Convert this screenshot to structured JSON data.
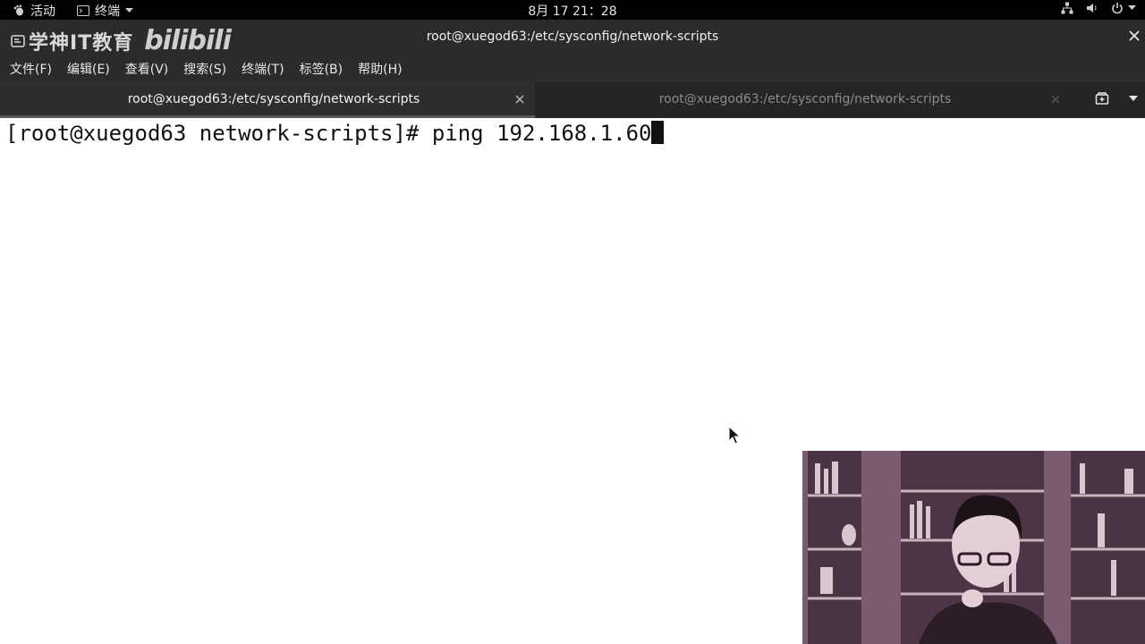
{
  "topbar": {
    "activities": "活动",
    "app_menu": "终端",
    "clock": "8月 17  21：28"
  },
  "window": {
    "title": "root@xuegod63:/etc/sysconfig/network-scripts",
    "logo_text": "学神IT教育",
    "logo_bili": "bilibili"
  },
  "menubar": {
    "items": [
      "文件(F)",
      "编辑(E)",
      "查看(V)",
      "搜索(S)",
      "终端(T)",
      "标签(B)",
      "帮助(H)"
    ]
  },
  "tabs": [
    {
      "label": "root@xuegod63:/etc/sysconfig/network-scripts",
      "active": true
    },
    {
      "label": "root@xuegod63:/etc/sysconfig/network-scripts",
      "active": false
    }
  ],
  "terminal": {
    "prompt": "[root@xuegod63 network-scripts]# ",
    "command": "ping 192.168.1.60"
  },
  "colors": {
    "terminal_bg": "#ffffff",
    "chrome_bg": "#2b2b2b",
    "topbar_bg": "#000000"
  },
  "icons": {
    "activities": "gnome-foot-icon",
    "app_menu": "terminal-icon",
    "network": "network-icon",
    "volume": "volume-icon",
    "power": "power-icon"
  }
}
